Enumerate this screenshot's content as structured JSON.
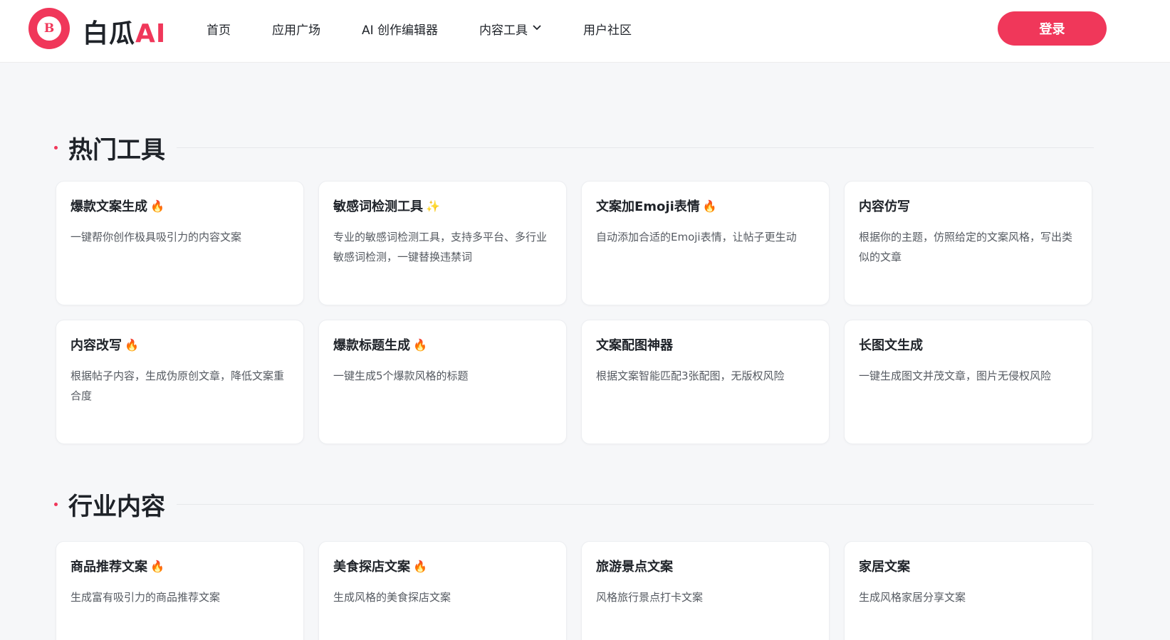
{
  "header": {
    "brand_main": "白瓜",
    "brand_ai": "AI",
    "logo_text": "B",
    "nav": [
      {
        "label": "首页",
        "has_dropdown": false
      },
      {
        "label": "应用广场",
        "has_dropdown": false
      },
      {
        "label": "AI 创作编辑器",
        "has_dropdown": false
      },
      {
        "label": "内容工具",
        "has_dropdown": true
      },
      {
        "label": "用户社区",
        "has_dropdown": false
      }
    ],
    "login_label": "登录"
  },
  "colors": {
    "accent": "#f0375a",
    "background": "#f6f7f9",
    "card": "#ffffff"
  },
  "sections": [
    {
      "title": "热门工具",
      "cards": [
        {
          "title": "爆款文案生成",
          "tag": "🔥",
          "desc": "一键帮你创作极具吸引力的内容文案"
        },
        {
          "title": "敏感词检测工具",
          "tag": "✨",
          "desc": "专业的敏感词检测工具，支持多平台、多行业敏感词检测，一键替换违禁词"
        },
        {
          "title": "文案加Emoji表情",
          "tag": "🔥",
          "desc": "自动添加合适的Emoji表情，让帖子更生动"
        },
        {
          "title": "内容仿写",
          "tag": "",
          "desc": "根据你的主题，仿照给定的文案风格，写出类似的文章"
        },
        {
          "title": "内容改写",
          "tag": "🔥",
          "desc": "根据帖子内容，生成伪原创文章，降低文案重合度"
        },
        {
          "title": "爆款标题生成",
          "tag": "🔥",
          "desc": "一键生成5个爆款风格的标题"
        },
        {
          "title": "文案配图神器",
          "tag": "",
          "desc": "根据文案智能匹配3张配图，无版权风险"
        },
        {
          "title": "长图文生成",
          "tag": "",
          "desc": "一键生成图文并茂文章，图片无侵权风险"
        }
      ]
    },
    {
      "title": "行业内容",
      "cards": [
        {
          "title": "商品推荐文案",
          "tag": "🔥",
          "desc": "生成富有吸引力的商品推荐文案"
        },
        {
          "title": "美食探店文案",
          "tag": "🔥",
          "desc": "生成风格的美食探店文案"
        },
        {
          "title": "旅游景点文案",
          "tag": "",
          "desc": "风格旅行景点打卡文案"
        },
        {
          "title": "家居文案",
          "tag": "",
          "desc": "生成风格家居分享文案"
        }
      ]
    }
  ]
}
